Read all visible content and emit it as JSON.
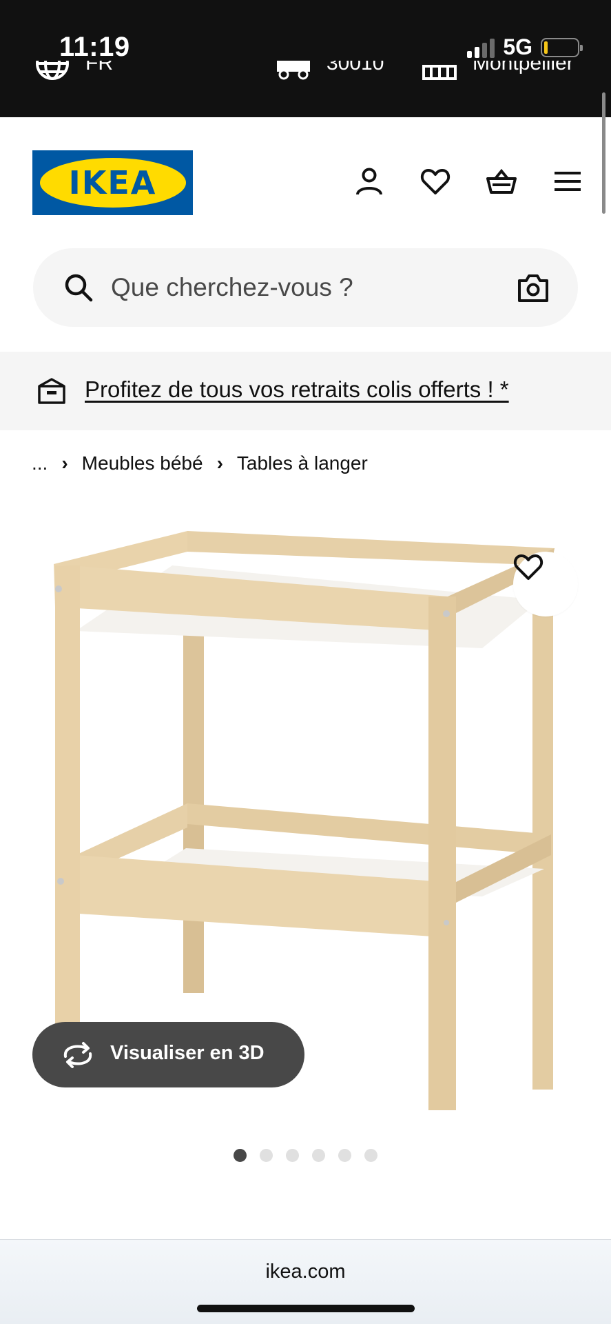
{
  "status_bar": {
    "time": "11:19",
    "network": "5G",
    "signal_bars": 4,
    "signal_bars_active": 2,
    "battery_level": 0.1,
    "battery_color": "#f5c518"
  },
  "top_strip": {
    "language": "FR",
    "postcode": "30010",
    "store": "Montpellier"
  },
  "header": {
    "logo_text": "IKEA",
    "brand_blue": "#0058a3",
    "brand_yellow": "#ffdb00",
    "icons": [
      "user-icon",
      "heart-icon",
      "basket-icon",
      "menu-icon"
    ]
  },
  "search": {
    "placeholder": "Que cherchez-vous ?"
  },
  "promo": {
    "text": "Profitez de tous vos retraits colis offerts ! *"
  },
  "breadcrumb": {
    "items": [
      "...",
      "Meubles bébé",
      "Tables à langer"
    ]
  },
  "product": {
    "view_3d_label": "Visualiser en 3D",
    "carousel_count": 6,
    "carousel_active": 0
  },
  "browser": {
    "url": "ikea.com"
  }
}
